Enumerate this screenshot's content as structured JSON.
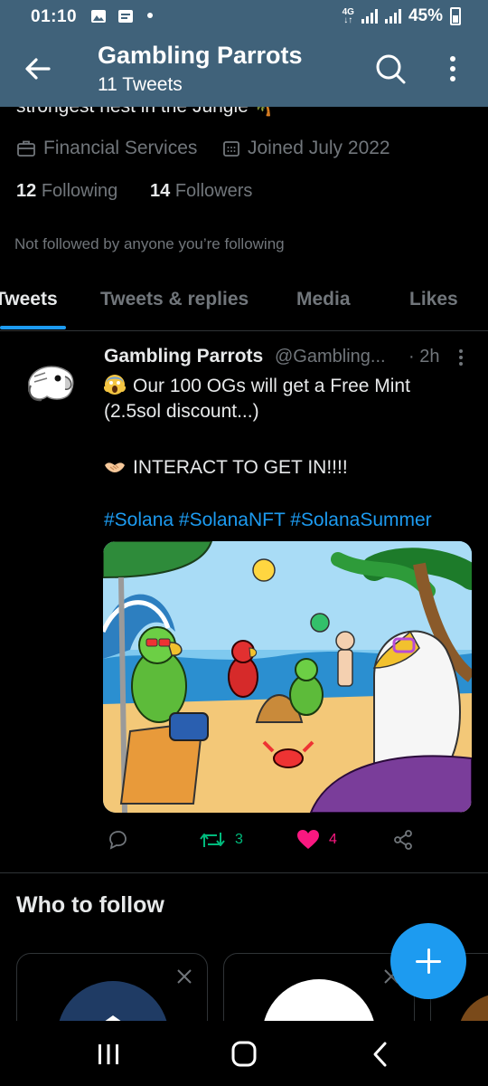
{
  "status_bar": {
    "time": "01:10",
    "network": "4G",
    "battery": "45%"
  },
  "header": {
    "title": "Gambling Parrots",
    "subtitle": "11 Tweets"
  },
  "profile": {
    "bio_partial": "strongest nest in the Jungle 🌴",
    "category": "Financial Services",
    "joined": "Joined July 2022",
    "following_count": "12",
    "following_label": "Following",
    "followers_count": "14",
    "followers_label": "Followers",
    "not_followed": "Not followed by anyone you’re following"
  },
  "tabs": [
    {
      "label": "Tweets"
    },
    {
      "label": "Tweets & replies"
    },
    {
      "label": "Media"
    },
    {
      "label": "Likes"
    }
  ],
  "tweet": {
    "name": "Gambling Parrots",
    "handle": "@Gambling...",
    "time": "· 2h",
    "line1": "Our 100 OGs will get a Free Mint",
    "line2": "(2.5sol discount...)",
    "line3": "INTERACT TO GET IN!!!!",
    "hashtags": "#Solana #SolanaNFT #SolanaSummer",
    "retweets": "3",
    "likes": "4"
  },
  "who_to_follow": {
    "title": "Who to follow"
  },
  "colors": {
    "header_bg": "#40627a",
    "accent": "#1d9bf0",
    "retweet": "#00ba7c",
    "like": "#f91880"
  },
  "icons": [
    "back-arrow-icon",
    "search-icon",
    "more-vertical-icon",
    "briefcase-icon",
    "calendar-icon",
    "reply-icon",
    "retweet-icon",
    "heart-icon",
    "share-icon",
    "compose-icon",
    "close-icon",
    "recents-icon",
    "home-icon",
    "back-nav-icon"
  ]
}
